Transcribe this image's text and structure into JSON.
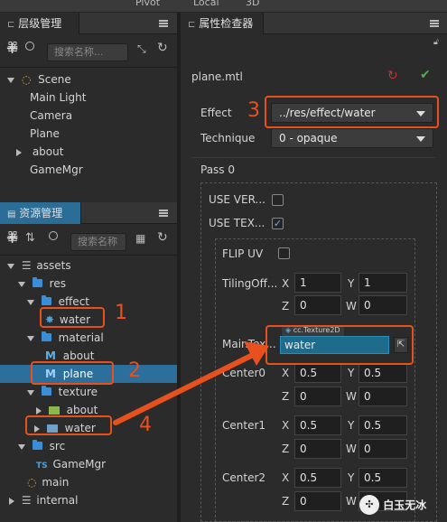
{
  "toolbar": {
    "pivot": "Pivot",
    "local": "Local",
    "mode3d": "3D"
  },
  "hierarchy": {
    "title": "层级管理器",
    "search_placeholder": "搜索名称...",
    "items": [
      "Scene",
      "Main Light",
      "Camera",
      "Plane",
      "about",
      "GameMgr"
    ]
  },
  "assets": {
    "title": "资源管理器",
    "search_placeholder": "搜索名称",
    "items": {
      "assets": "assets",
      "res": "res",
      "effect": "effect",
      "water_effect": "water",
      "material": "material",
      "about_mat": "about",
      "plane_mat": "plane",
      "texture": "texture",
      "about_tex": "about",
      "water_tex": "water",
      "src": "src",
      "gamemgr": "GameMgr",
      "main": "main",
      "internal": "internal"
    }
  },
  "inspector": {
    "title": "属性检查器",
    "filename": "plane.mtl",
    "effect_label": "Effect",
    "effect_value": "../res/effect/water",
    "technique_label": "Technique",
    "technique_value": "0 - opaque",
    "pass_label": "Pass 0",
    "use_vert_label": "USE VER...",
    "use_tex_label": "USE TEX...",
    "flip_uv_label": "FLIP UV",
    "tiling_label": "TilingOff...",
    "tiling": {
      "x": "1",
      "y": "1",
      "z": "0",
      "w": "0"
    },
    "maintex_label": "MainTex...",
    "maintex_tag": "cc.Texture2D",
    "maintex_value": "water",
    "center0_label": "Center0",
    "center0": {
      "x": "0.5",
      "y": "0.5",
      "z": "0",
      "w": "0"
    },
    "center1_label": "Center1",
    "center1": {
      "x": "0.5",
      "y": "0.5",
      "z": "0",
      "w": "0"
    },
    "center2_label": "Center2",
    "center2": {
      "x": "0.5",
      "y": "0.5",
      "z": "0",
      "w": "0"
    },
    "axis_x": "X",
    "axis_y": "Y",
    "axis_z": "Z",
    "axis_w": "W"
  },
  "annotations": {
    "n1": "1",
    "n2": "2",
    "n3": "3",
    "n4": "4"
  },
  "watermark": "白玉无冰"
}
